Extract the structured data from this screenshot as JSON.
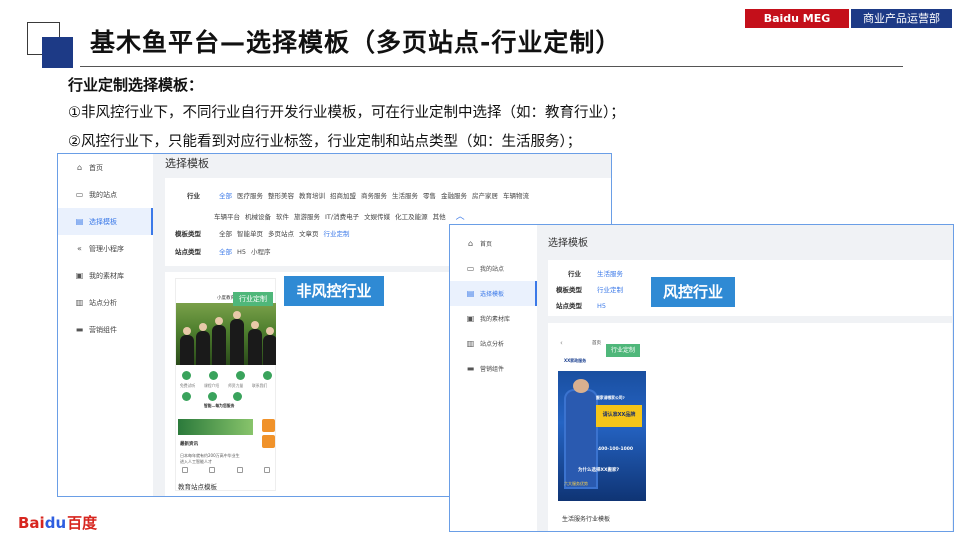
{
  "header": {
    "title": "基木鱼平台—选择模板（多页站点-行业定制）",
    "tag_company": "Baidu MEG",
    "tag_dept": "商业产品运营部"
  },
  "body_text": {
    "heading": "行业定制选择模板：",
    "line1": "①非风控行业下，不同行业自行开发行业模板，可在行业定制中选择（如：教育行业）；",
    "line2": "②风控行业下，只能看到对应行业标签，行业定制和站点类型（如：生活服务）；"
  },
  "logo": {
    "bai": "Bai",
    "du": "du",
    "cn": "百度"
  },
  "nav": [
    {
      "icon": "home-icon",
      "label": "首页"
    },
    {
      "icon": "site-icon",
      "label": "我的站点"
    },
    {
      "icon": "template-icon",
      "label": "选择模板"
    },
    {
      "icon": "mini-program-icon",
      "label": "管理小程序"
    },
    {
      "icon": "material-icon",
      "label": "我的素材库"
    },
    {
      "icon": "chart-icon",
      "label": "站点分析"
    },
    {
      "icon": "marketing-icon",
      "label": "营销组件"
    }
  ],
  "shot1": {
    "page_title": "选择模板",
    "industry_label": "行业",
    "industry_row1": [
      "全部",
      "医疗服务",
      "整形美容",
      "教育培训",
      "招商加盟",
      "商务服务",
      "生活服务",
      "零售",
      "金融服务",
      "房产家居",
      "车辆物流"
    ],
    "industry_row2": [
      "车辆平台",
      "机械设备",
      "软件",
      "旅游服务",
      "IT/消费电子",
      "文娱传媒",
      "化工及能源",
      "其他"
    ],
    "collapse_glyph": "︿",
    "template_type_label": "模板类型",
    "template_types": [
      "全部",
      "智能单页",
      "多页站点",
      "文章页",
      "行业定制"
    ],
    "site_type_label": "站点类型",
    "site_types": [
      "全部",
      "H5",
      "小程序"
    ],
    "card": {
      "phone_header": "小度教育",
      "badge": "行业定制",
      "icon_labels": [
        "免费试听",
        "课程介绍",
        "师资力量",
        "联系我们"
      ],
      "promo_title": "智能—每为您服务",
      "news_title": "最新资讯",
      "news_lines": [
        "日本每年就有约200万高中毕业生",
        "进入人工智能人才"
      ],
      "caption": "教育站点模板"
    }
  },
  "callout1": "非风控行业",
  "callout2": "风控行业",
  "shot2": {
    "page_title": "选择模板",
    "industry_label": "行业",
    "industry_value": "生活服务",
    "template_type_label": "模板类型",
    "template_type_value": "行业定制",
    "site_type_label": "站点类型",
    "site_type_value": "H5",
    "back_glyph": "‹",
    "card": {
      "phone_header": "首页",
      "company": "XX家政服务",
      "badge": "行业定制",
      "hero_question": "搬家请哪家公司?",
      "hero_headline": "请认准XX品牌",
      "phone_line": "400-100-1000",
      "why_line": "为什么选择XX搬家?",
      "adv_line": "六大服务优势",
      "caption": "生活服务行业模板"
    }
  }
}
